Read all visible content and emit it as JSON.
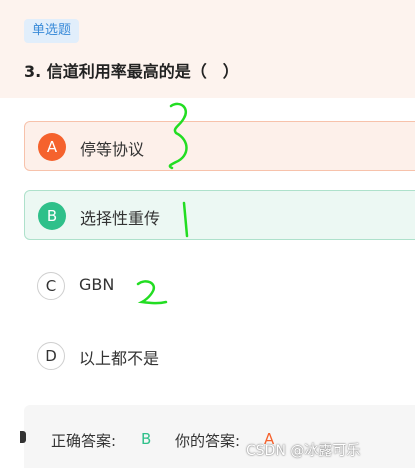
{
  "question": {
    "type_tag": "单选题",
    "title": "3. 信道利用率最高的是（　）"
  },
  "options": [
    {
      "letter": "A",
      "text": "停等协议",
      "state": "wrong-selected"
    },
    {
      "letter": "B",
      "text": "选择性重传",
      "state": "correct"
    },
    {
      "letter": "C",
      "text": "GBN",
      "state": "plain"
    },
    {
      "letter": "D",
      "text": "以上都不是",
      "state": "plain"
    }
  ],
  "answer": {
    "correct_label": "正确答案:",
    "correct_value": "B",
    "yours_label": "你的答案:",
    "yours_value": "A"
  },
  "watermark": "CSDN @冰露可乐",
  "colors": {
    "wrong": "#f5622d",
    "correct": "#2fc08a",
    "handwriting": "#22dd22",
    "tag_text": "#3a8bd8"
  },
  "handwritten_marks": [
    "3",
    "1",
    "2"
  ]
}
